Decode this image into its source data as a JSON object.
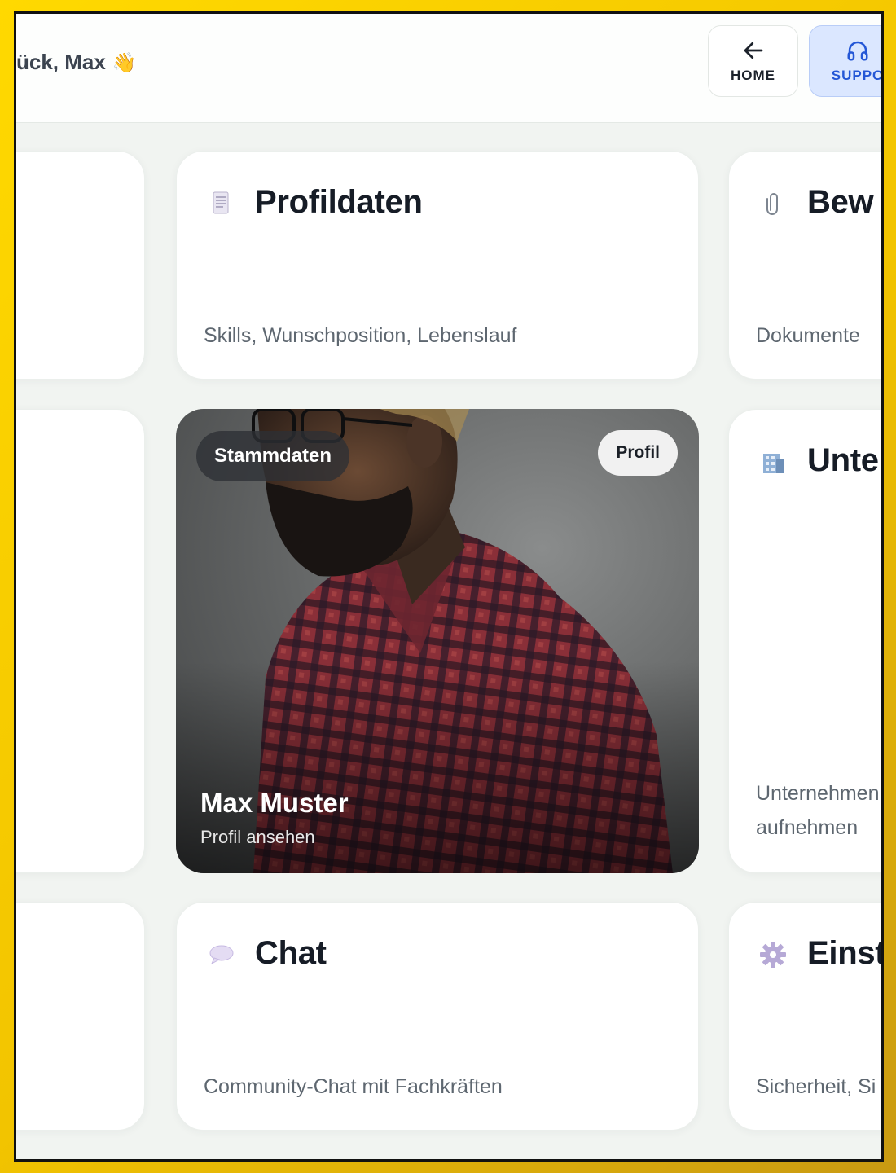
{
  "header": {
    "greeting": "ück, Max",
    "wave_icon": "waving-hand-icon",
    "home_label": "HOME",
    "home_icon": "arrow-left-icon",
    "support_label": "SUPPO",
    "support_icon": "headphones-icon"
  },
  "cards": {
    "profildaten": {
      "title": "Profildaten",
      "description": "Skills, Wunschposition, Lebenslauf",
      "icon": "document-icon"
    },
    "bewerbung": {
      "title": "Bew",
      "description": "Dokumente",
      "icon": "paperclip-icon"
    },
    "unternehmen": {
      "title": "Unte",
      "description": "Unternehmen aufnehmen",
      "icon": "building-icon"
    },
    "chat": {
      "title": "Chat",
      "description": "Community-Chat mit Fachkräften",
      "icon": "speech-bubble-icon"
    },
    "einstellungen": {
      "title": "Einst",
      "description": "Sicherheit, Si",
      "icon": "gear-icon"
    }
  },
  "profile_card": {
    "badge": "Stammdaten",
    "tag": "Profil",
    "name": "Max Muster",
    "link": "Profil ansehen"
  },
  "colors": {
    "accent": "#2457d6",
    "support_bg": "#dbe7ff",
    "page_bg": "#f1f4f1",
    "frame": "#ffd900"
  }
}
